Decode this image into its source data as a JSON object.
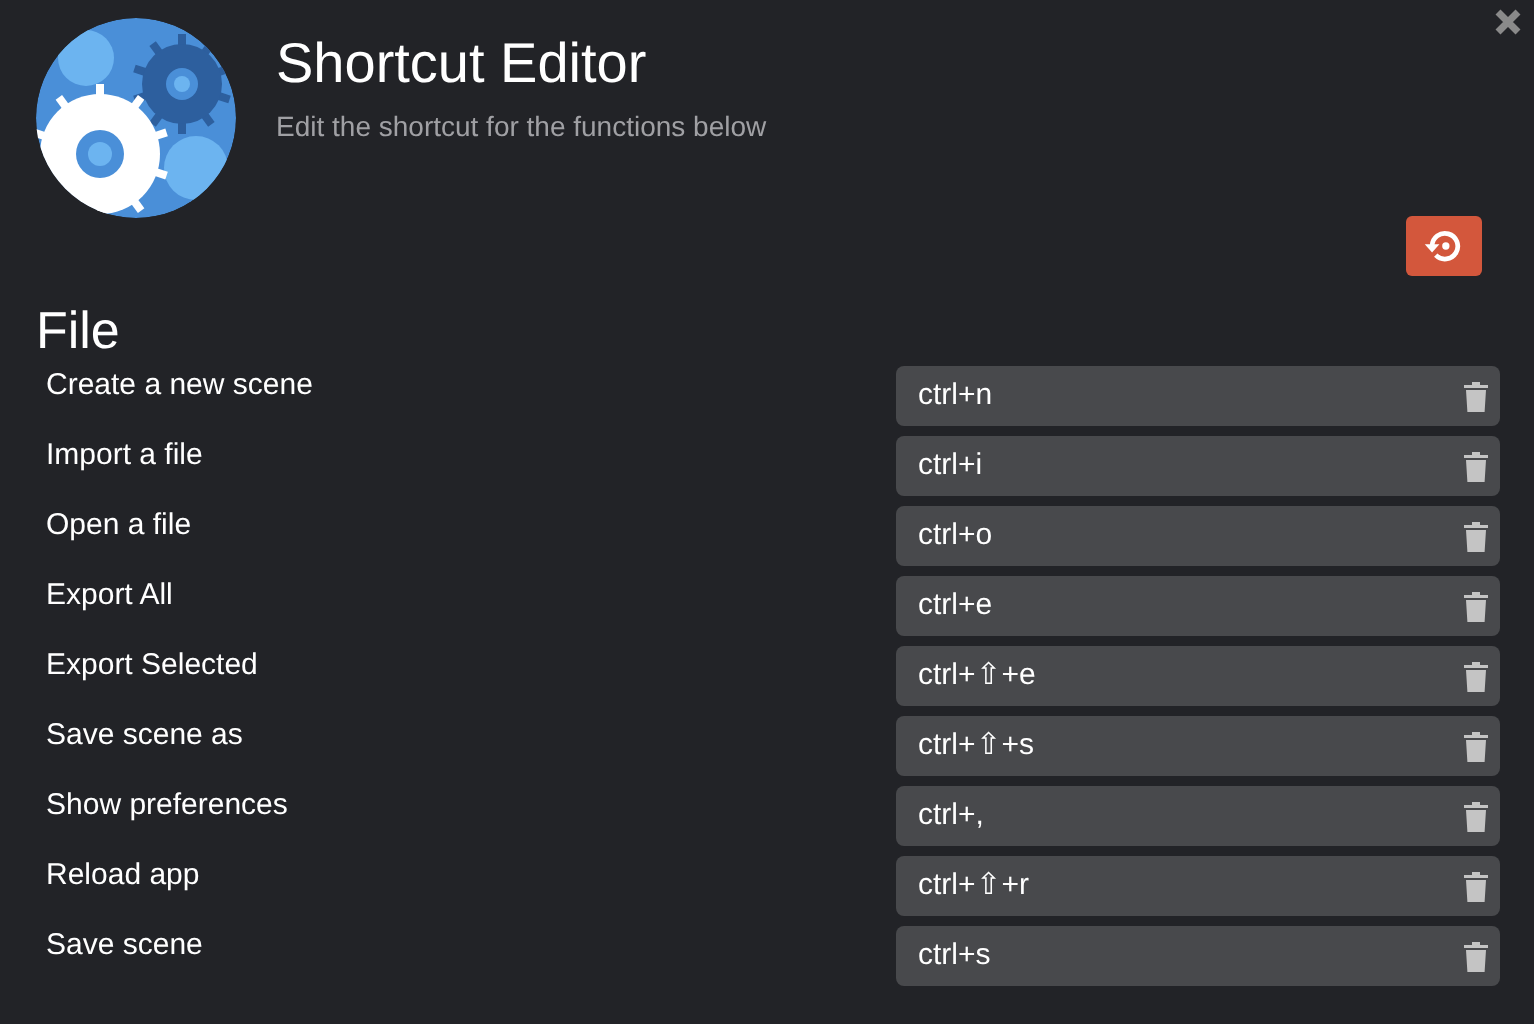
{
  "header": {
    "title": "Shortcut Editor",
    "subtitle": "Edit the shortcut for the functions below"
  },
  "sections": [
    {
      "title": "File",
      "shortcuts": [
        {
          "label": "Create a new scene",
          "value": "ctrl+n"
        },
        {
          "label": "Import a file",
          "value": "ctrl+i"
        },
        {
          "label": "Open a file",
          "value": "ctrl+o"
        },
        {
          "label": "Export All",
          "value": "ctrl+e"
        },
        {
          "label": "Export Selected",
          "value": "ctrl+⇧+e"
        },
        {
          "label": "Save scene as",
          "value": "ctrl+⇧+s"
        },
        {
          "label": "Show preferences",
          "value": "ctrl+,"
        },
        {
          "label": "Reload app",
          "value": "ctrl+⇧+r"
        },
        {
          "label": "Save scene",
          "value": "ctrl+s"
        }
      ]
    }
  ]
}
